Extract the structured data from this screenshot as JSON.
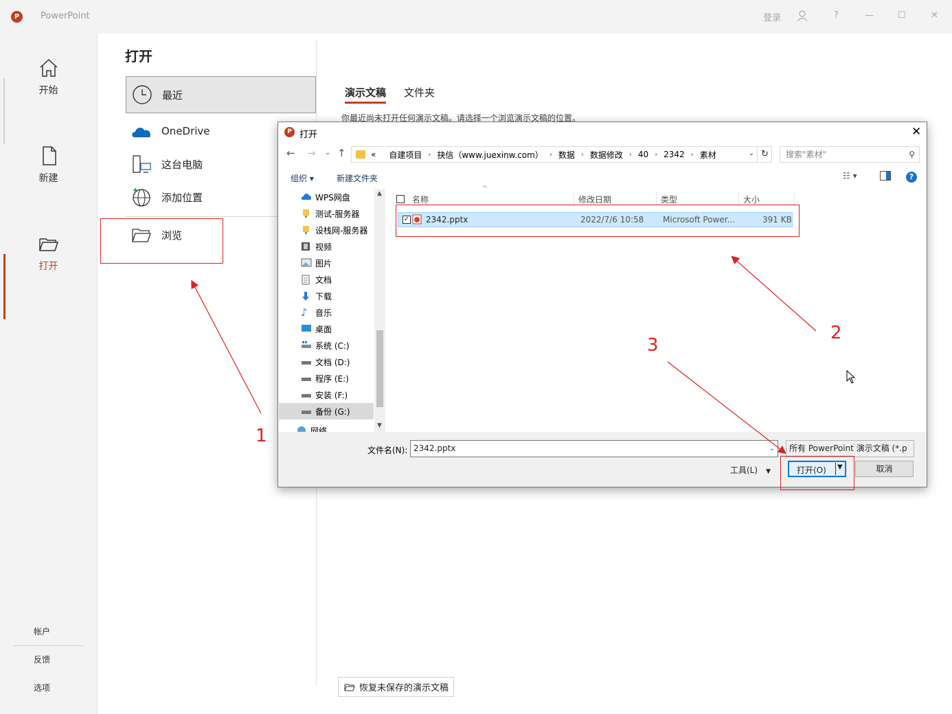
{
  "titlebar": {
    "app_title": "PowerPoint",
    "logo_letter": "P",
    "signin": "登录",
    "help": "?",
    "minimize": "—",
    "maximize": "☐",
    "close": "✕"
  },
  "rail": {
    "items": [
      {
        "label": "开始",
        "icon": "home-icon"
      },
      {
        "label": "新建",
        "icon": "new-file-icon"
      },
      {
        "label": "打开",
        "icon": "open-folder-icon"
      }
    ],
    "bottom": [
      "帐户",
      "反馈",
      "选项"
    ]
  },
  "main": {
    "title": "打开",
    "locations": [
      {
        "label": "最近",
        "icon": "clock-icon"
      },
      {
        "label": "OneDrive",
        "icon": "onedrive-icon"
      },
      {
        "label": "这台电脑",
        "icon": "computer-icon"
      },
      {
        "label": "添加位置",
        "icon": "globe-icon"
      },
      {
        "label": "浏览",
        "icon": "folder-icon"
      }
    ],
    "tabs": [
      "演示文稿",
      "文件夹"
    ],
    "hint": "你最近尚未打开任何演示文稿。请选择一个浏览演示文稿的位置。",
    "recover": "恢复未保存的演示文稿"
  },
  "dialog": {
    "title": "打开",
    "breadcrumb": [
      "«",
      "自建项目",
      "抉信（www.juexinw.com）",
      "数据",
      "数据修改",
      "40",
      "2342",
      "素材"
    ],
    "search_placeholder": "搜索\"素材\"",
    "toolbar": {
      "organize": "组织 ▾",
      "new_folder": "新建文件夹"
    },
    "nav_items": [
      "WPS网盘",
      "测试-服务器",
      "设栈网-服务器",
      "视频",
      "图片",
      "文档",
      "下载",
      "音乐",
      "桌面",
      "系统 (C:)",
      "文档 (D:)",
      "程序 (E:)",
      "安装 (F:)",
      "备份 (G:)",
      "网络"
    ],
    "columns": [
      "名称",
      "修改日期",
      "类型",
      "大小"
    ],
    "files": [
      {
        "name": "2342.pptx",
        "modified": "2022/7/6 10:58",
        "type": "Microsoft Power...",
        "size": "391 KB"
      }
    ],
    "filename_label": "文件名(N):",
    "filename_value": "2342.pptx",
    "filter_value": "所有 PowerPoint 演示文稿 (*.p",
    "tools_label": "工具(L)",
    "open_button": "打开(O)",
    "cancel_button": "取消"
  },
  "annotations": {
    "steps": [
      "1",
      "2",
      "3"
    ],
    "color": "#e02020"
  },
  "colors": {
    "accent": "#c43e1c",
    "selection": "#cce8ff",
    "dialog_button_border": "#0078d7"
  }
}
